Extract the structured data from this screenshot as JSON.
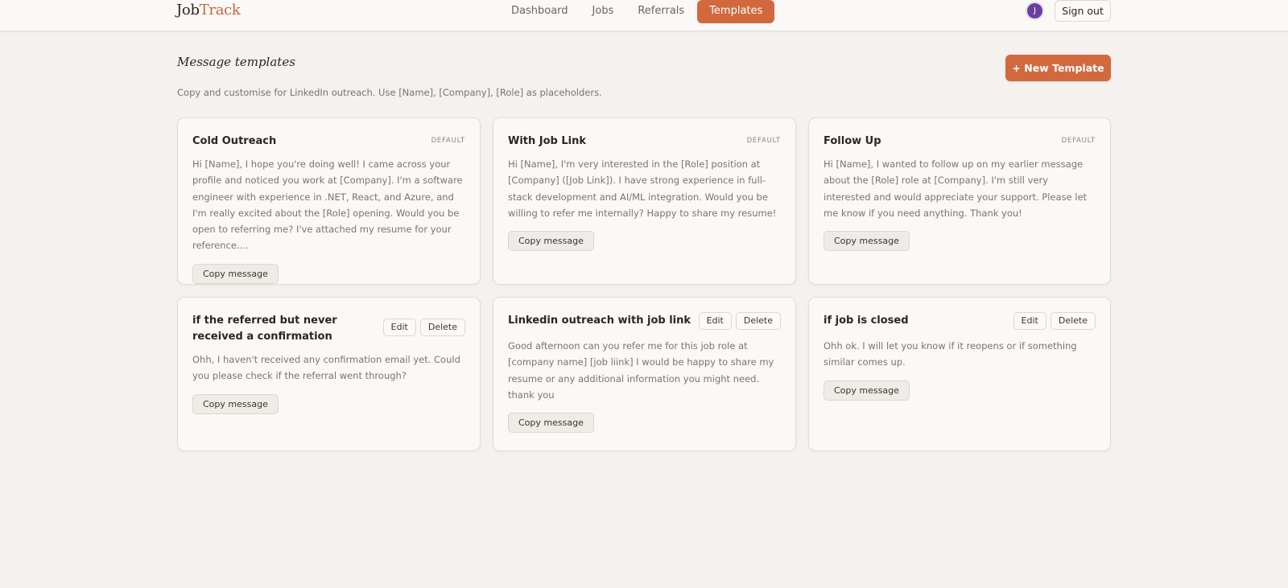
{
  "brand": {
    "part1": "Job",
    "part2": "Track"
  },
  "nav": {
    "items": [
      {
        "label": "Dashboard"
      },
      {
        "label": "Jobs"
      },
      {
        "label": "Referrals"
      },
      {
        "label": "Templates"
      }
    ],
    "active": "Templates"
  },
  "user": {
    "avatar_initial": "J",
    "signout_label": "Sign out"
  },
  "page": {
    "title": "Message templates",
    "subtitle": "Copy and customise for LinkedIn outreach. Use [Name], [Company], [Role] as placeholders.",
    "new_button": "+ New Template"
  },
  "templates": [
    {
      "title": "Cold Outreach",
      "badge": "DEFAULT",
      "body": "Hi [Name], I hope you're doing well! I came across your profile and noticed you work at [Company]. I'm a software engineer with experience in .NET, React, and Azure, and I'm really excited about the [Role] opening. Would you be open to referring me? I've attached my resume for your reference....",
      "copy_label": "Copy message"
    },
    {
      "title": "With Job Link",
      "badge": "DEFAULT",
      "body": "Hi [Name], I'm very interested in the [Role] position at [Company] ([Job Link]). I have strong experience in full-stack development and AI/ML integration. Would you be willing to refer me internally? Happy to share my resume!",
      "copy_label": "Copy message"
    },
    {
      "title": "Follow Up",
      "badge": "DEFAULT",
      "body": "Hi [Name], I wanted to follow up on my earlier message about the [Role] role at [Company]. I'm still very interested and would appreciate your support. Please let me know if you need anything. Thank you!",
      "copy_label": "Copy message"
    },
    {
      "title": "if the referred but never received a confirmation",
      "edit_label": "Edit",
      "delete_label": "Delete",
      "body": "Ohh, I haven't received any confirmation email yet. Could you please check if the referral went through?",
      "copy_label": "Copy message"
    },
    {
      "title": "Linkedin outreach with job link",
      "edit_label": "Edit",
      "delete_label": "Delete",
      "body": "Good afternoon can you refer me for this job role at [company name] [job liink] I would be happy to share my resume or any additional information you might need. thank you",
      "copy_label": "Copy message"
    },
    {
      "title": "if job is closed",
      "edit_label": "Edit",
      "delete_label": "Delete",
      "body": "Ohh ok. I will let you know if it reopens or if something similar comes up.",
      "copy_label": "Copy message"
    }
  ]
}
